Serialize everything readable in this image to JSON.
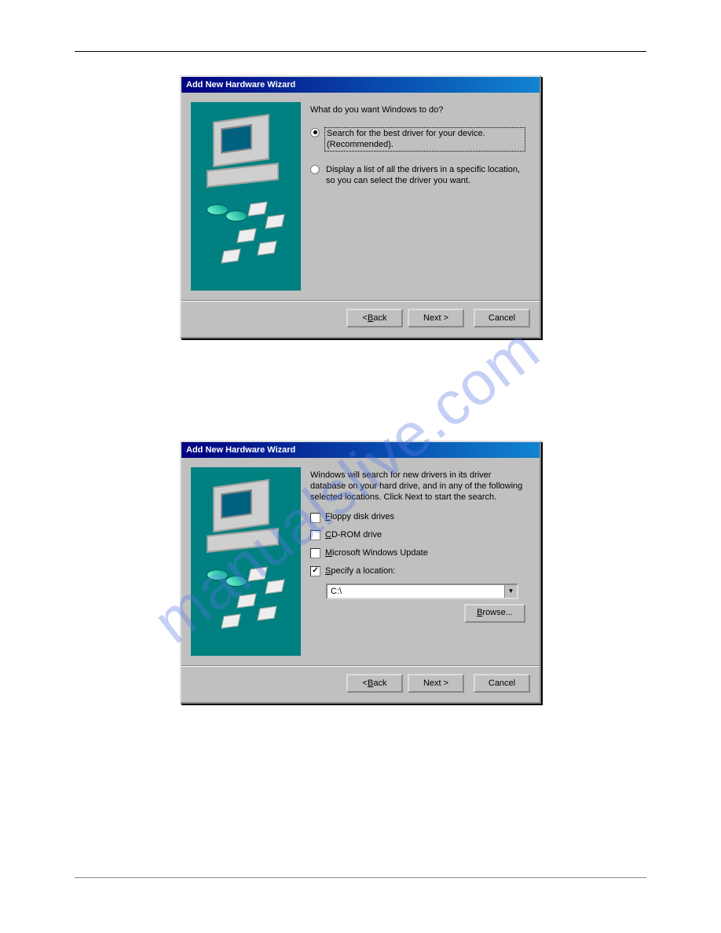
{
  "watermark": "manualslive.com",
  "dialog1": {
    "title": "Add New Hardware Wizard",
    "question": "What do you want Windows to do?",
    "option1": "Search for the best driver for your device. (Recommended).",
    "option2": "Display a list of all the drivers in a specific location, so you can select the driver you want.",
    "back_prefix": "< ",
    "back_letter": "B",
    "back_rest": "ack",
    "next": "Next >",
    "cancel": "Cancel"
  },
  "dialog2": {
    "title": "Add New Hardware Wizard",
    "desc": "Windows will search for new drivers in its driver database on your hard drive, and in any of the following selected locations. Click Next to start the search.",
    "floppy_letter": "F",
    "floppy_rest": "loppy disk drives",
    "cd_letter": "C",
    "cd_rest": "D-ROM drive",
    "upd_letter": "M",
    "upd_rest": "icrosoft Windows Update",
    "specify_letter": "S",
    "specify_rest": "pecify a location:",
    "location_value": "C:\\",
    "browse_letter": "B",
    "browse_rest": "rowse...",
    "back_prefix": "< ",
    "back_letter": "B",
    "back_rest": "ack",
    "next": "Next >",
    "cancel": "Cancel"
  }
}
